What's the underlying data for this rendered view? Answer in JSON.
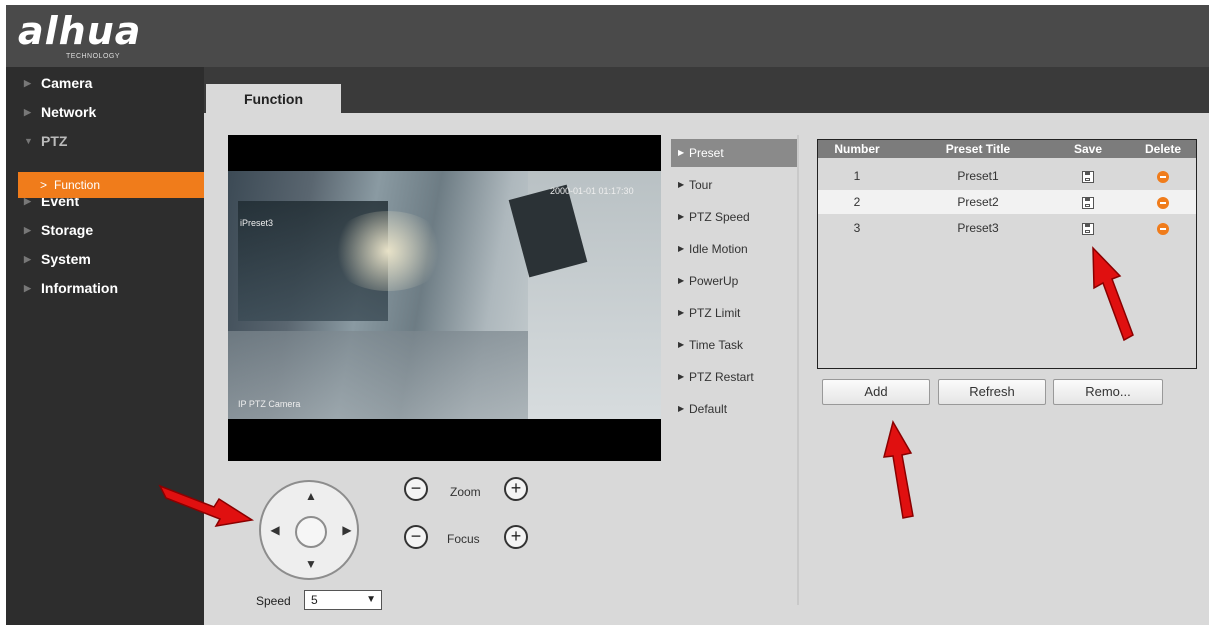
{
  "brand": {
    "logo": "alhua",
    "sub": "TECHNOLOGY"
  },
  "sidebar": {
    "items": [
      {
        "label": "Camera"
      },
      {
        "label": "Network"
      },
      {
        "label": "PTZ"
      },
      {
        "label": "Event"
      },
      {
        "label": "Storage"
      },
      {
        "label": "System"
      },
      {
        "label": "Information"
      }
    ],
    "active_sub": "Function"
  },
  "tab": {
    "label": "Function"
  },
  "video": {
    "timestamp": "2000-01-01 01:17:30",
    "preset_label": "iPreset3",
    "camera_name": "IP PTZ Camera"
  },
  "controls": {
    "zoom_label": "Zoom",
    "focus_label": "Focus",
    "minus": "−",
    "plus": "+",
    "speed_label": "Speed",
    "speed_value": "5"
  },
  "menu": {
    "items": [
      "Preset",
      "Tour",
      "PTZ Speed",
      "Idle Motion",
      "PowerUp",
      "PTZ Limit",
      "Time Task",
      "PTZ Restart",
      "Default"
    ],
    "active": "Preset"
  },
  "table": {
    "headers": [
      "Number",
      "Preset Title",
      "Save",
      "Delete"
    ],
    "rows": [
      {
        "number": "1",
        "title": "Preset1"
      },
      {
        "number": "2",
        "title": "Preset2"
      },
      {
        "number": "3",
        "title": "Preset3"
      }
    ]
  },
  "buttons": {
    "add": "Add",
    "refresh": "Refresh",
    "remove": "Remo..."
  },
  "colors": {
    "accent": "#f07c1b",
    "annotation_arrow": "#e01010"
  }
}
